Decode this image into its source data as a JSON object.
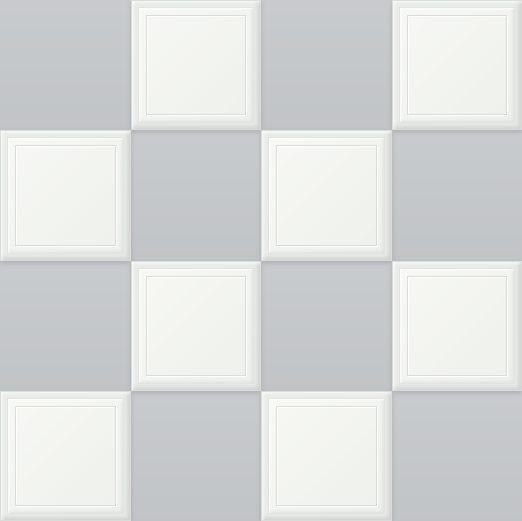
{
  "pattern": {
    "rows": 4,
    "cols": 4,
    "colors": {
      "dark_tile": "#c4c7c9",
      "light_tile": "#eef0ec"
    }
  }
}
